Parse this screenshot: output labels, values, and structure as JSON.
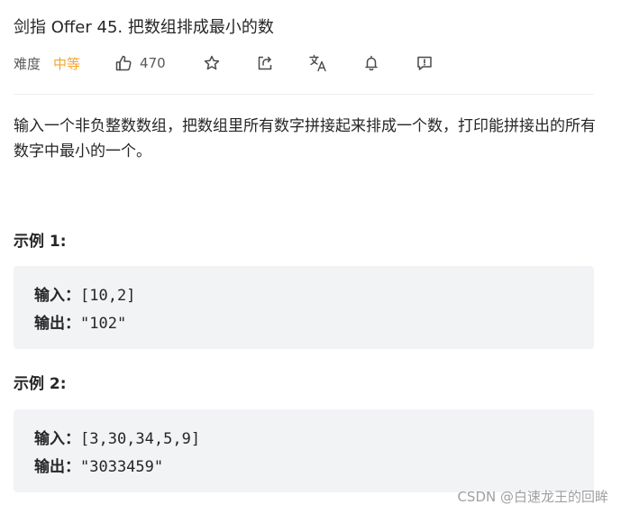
{
  "header": {
    "title": "剑指 Offer 45. 把数组排成最小的数"
  },
  "meta": {
    "difficulty_label": "难度",
    "difficulty_value": "中等",
    "like_count": "470",
    "icons": [
      "thumbs-up-icon",
      "star-icon",
      "share-icon",
      "translate-icon",
      "bell-icon",
      "feedback-icon"
    ],
    "difficulty_color": "#f7a330"
  },
  "description": "输入一个非负整数数组，把数组里所有数字拼接起来排成一个数，打印能拼接出的所有数字中最小的一个。",
  "examples": [
    {
      "title": "示例 1:",
      "input_label": "输入：",
      "input_value": "[10,2]",
      "output_label": "输出：",
      "output_value": "\"102\""
    },
    {
      "title": "示例 2:",
      "input_label": "输入：",
      "input_value": "[3,30,34,5,9]",
      "output_label": "输出：",
      "output_value": "\"3033459\""
    }
  ],
  "watermark": "CSDN @白速龙王的回眸"
}
